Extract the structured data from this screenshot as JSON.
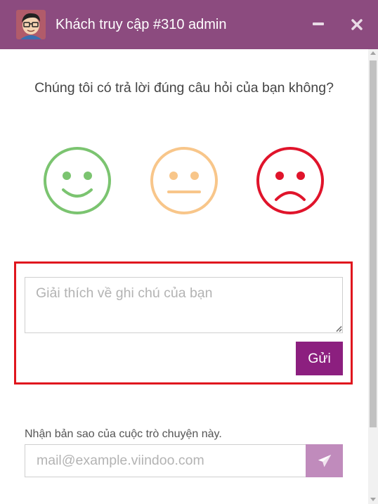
{
  "window": {
    "title": "Khách truy cập #310 admin",
    "header_color": "#8c4b7f"
  },
  "icons": {
    "avatar": "user-avatar-glasses",
    "minimize": "minimize-icon",
    "close": "close-icon",
    "send": "paper-plane-icon"
  },
  "rating": {
    "question": "Chúng tôi có trả lời đúng câu hỏi của bạn không?",
    "faces": [
      {
        "name": "good",
        "color": "#7bc470"
      },
      {
        "name": "neutral",
        "color": "#f8c68a"
      },
      {
        "name": "bad",
        "color": "#e0142b"
      }
    ]
  },
  "feedback": {
    "placeholder": "Giải thích về ghi chú của bạn",
    "value": "",
    "submit_label": "Gửi",
    "highlight_color": "#e0161e"
  },
  "transcript": {
    "label": "Nhận bản sao của cuộc trò chuyện này.",
    "email_placeholder": "mail@example.viindoo.com",
    "email_value": ""
  }
}
